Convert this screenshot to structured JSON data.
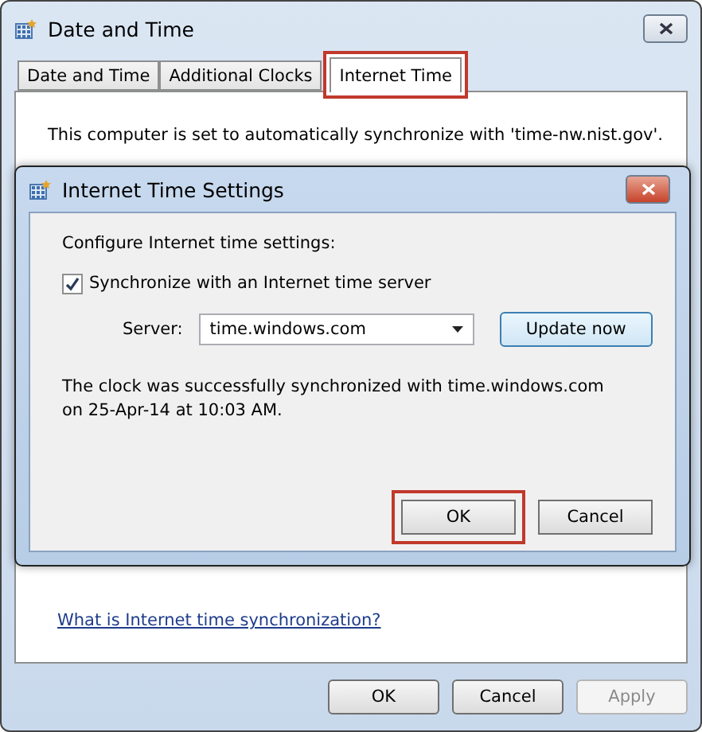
{
  "window": {
    "title": "Date and Time"
  },
  "tabs": [
    {
      "label": "Date and Time",
      "selected": false,
      "highlighted": false
    },
    {
      "label": "Additional Clocks",
      "selected": false,
      "highlighted": false
    },
    {
      "label": "Internet Time",
      "selected": true,
      "highlighted": true
    }
  ],
  "panel": {
    "status": "This computer is set to automatically synchronize with 'time-nw.nist.gov'.",
    "link": "What is Internet time synchronization?"
  },
  "dialog": {
    "title": "Internet Time Settings",
    "heading": "Configure Internet time settings:",
    "sync": {
      "label": "Synchronize with an Internet time server",
      "checked": true
    },
    "server": {
      "label": "Server:",
      "value": "time.windows.com"
    },
    "update_button": "Update now",
    "message": "The clock was successfully synchronized with time.windows.com on 25-Apr-14 at 10:03 AM.",
    "buttons": [
      {
        "label": "OK",
        "highlighted": true
      },
      {
        "label": "Cancel",
        "highlighted": false
      }
    ]
  },
  "buttons": [
    {
      "label": "OK",
      "disabled": false
    },
    {
      "label": "Cancel",
      "disabled": false
    },
    {
      "label": "Apply",
      "disabled": true
    }
  ]
}
